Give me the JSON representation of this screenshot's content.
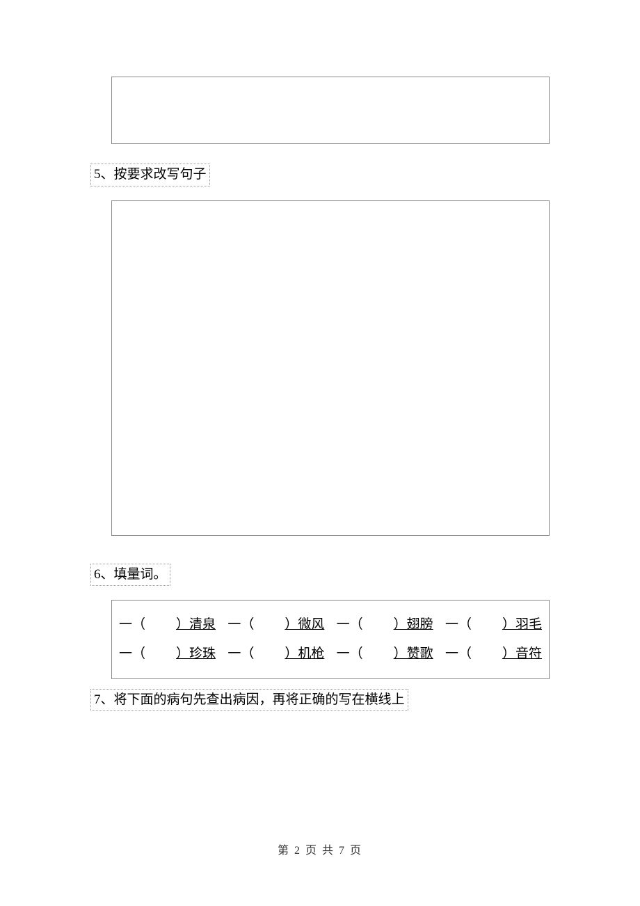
{
  "question5": {
    "label": "5、按要求改写句子"
  },
  "question6": {
    "label": "6、填量词。",
    "row1": {
      "item1": {
        "prefix": "一（",
        "suffix": "）清泉"
      },
      "item2": {
        "prefix": "一（",
        "suffix": "）微风"
      },
      "item3": {
        "prefix": "一（",
        "suffix": "）翅膀"
      },
      "item4": {
        "prefix": "一（",
        "suffix": "）羽毛"
      }
    },
    "row2": {
      "item1": {
        "prefix": "一（",
        "suffix": "）珍珠"
      },
      "item2": {
        "prefix": "一（",
        "suffix": "）机枪"
      },
      "item3": {
        "prefix": "一（",
        "suffix": "）赞歌"
      },
      "item4": {
        "prefix": "一（",
        "suffix": "）音符"
      }
    }
  },
  "question7": {
    "label": "7、将下面的病句先查出病因，再将正确的写在横线上"
  },
  "footer": {
    "text": "第 2 页 共 7 页"
  }
}
